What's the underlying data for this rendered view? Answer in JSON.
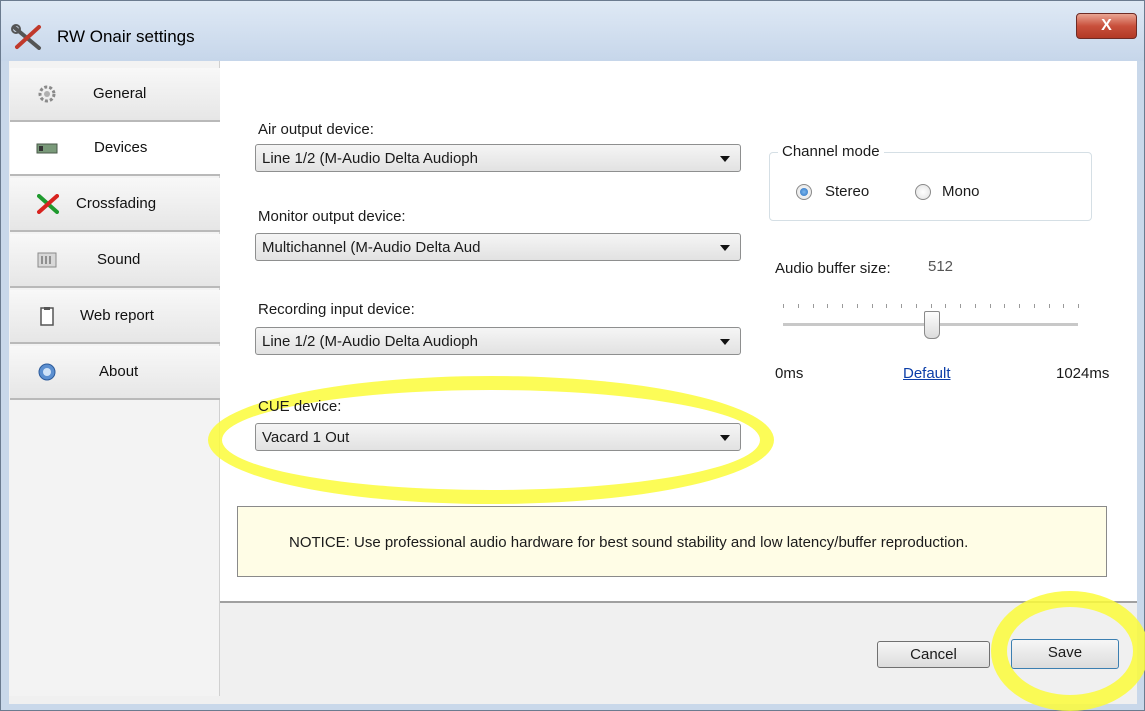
{
  "window": {
    "title": "RW Onair settings",
    "close_glyph": "X"
  },
  "sidebar": {
    "items": [
      {
        "label": "General",
        "icon": "gear-icon"
      },
      {
        "label": "Devices",
        "icon": "sound-card-icon"
      },
      {
        "label": "Crossfading",
        "icon": "red-green-x-icon"
      },
      {
        "label": "Sound",
        "icon": "equalizer-icon"
      },
      {
        "label": "Web report",
        "icon": "clipboard-icon"
      },
      {
        "label": "About",
        "icon": "info-globe-icon"
      }
    ],
    "active": "Devices"
  },
  "devices": {
    "air_output": {
      "label": "Air output device:",
      "value": "Line 1/2 (M-Audio Delta Audioph"
    },
    "monitor_output": {
      "label": "Monitor output device:",
      "value": "Multichannel (M-Audio Delta Aud"
    },
    "recording_input": {
      "label": "Recording input device:",
      "value": "Line 1/2 (M-Audio Delta Audioph"
    },
    "cue": {
      "label": "CUE device:",
      "value": "Vacard 1 Out"
    }
  },
  "channel_mode": {
    "title": "Channel mode",
    "options": [
      "Stereo",
      "Mono"
    ],
    "selected": "Stereo"
  },
  "buffer": {
    "label": "Audio buffer size:",
    "value": "512",
    "min_label": "0ms",
    "max_label": "1024ms",
    "default_link": "Default",
    "level": 0.5
  },
  "notice": "NOTICE: Use professional audio hardware for best sound stability and low latency/buffer reproduction.",
  "buttons": {
    "cancel": "Cancel",
    "save": "Save"
  },
  "colors": {
    "highlight": "#fbfc3a",
    "close": "#c9503c",
    "link": "#0b3ea8",
    "notice_bg": "#fffde6"
  }
}
